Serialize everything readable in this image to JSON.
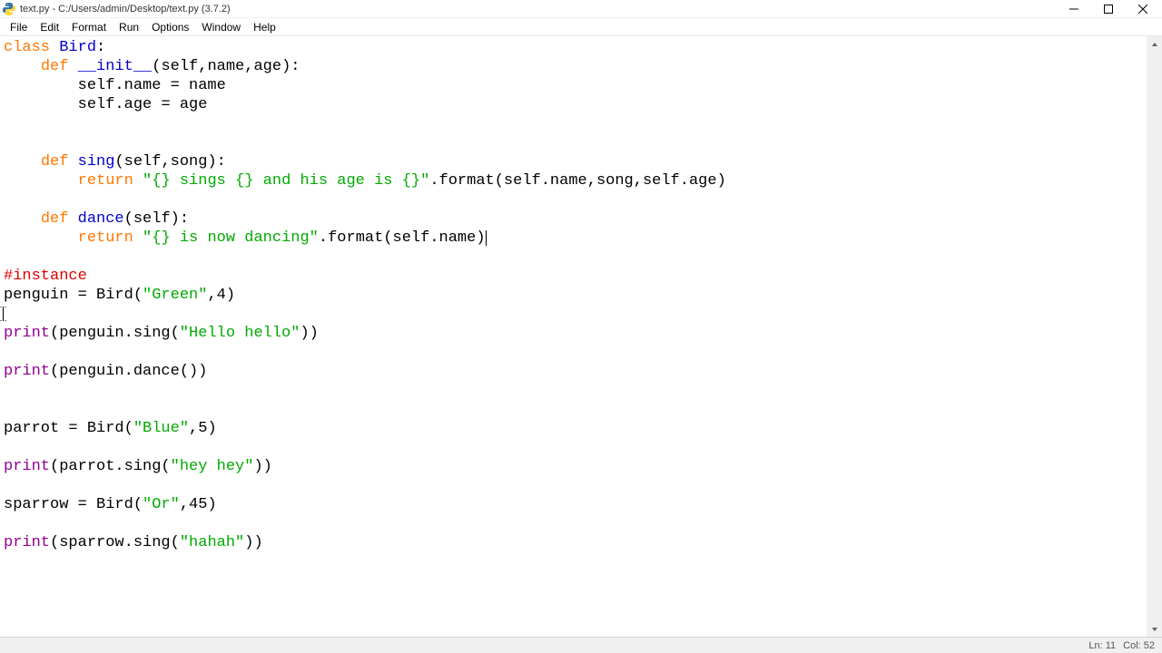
{
  "window": {
    "title": "text.py - C:/Users/admin/Desktop/text.py (3.7.2)"
  },
  "menu": {
    "file": "File",
    "edit": "Edit",
    "format": "Format",
    "run": "Run",
    "options": "Options",
    "window": "Window",
    "help": "Help"
  },
  "code": {
    "l1_kw": "class",
    "l1_name": " Bird",
    "l1_colon": ":",
    "l2_indent": "    ",
    "l2_kw": "def",
    "l2_name": " __init__",
    "l2_rest": "(self,name,age):",
    "l3": "        self.name = name",
    "l4": "        self.age = age",
    "l7_indent": "    ",
    "l7_kw": "def",
    "l7_name": " sing",
    "l7_rest": "(self,song):",
    "l8_indent": "        ",
    "l8_kw": "return",
    "l8_sp": " ",
    "l8_str": "\"{} sings {} and his age is {}\"",
    "l8_rest": ".format(self.name,song,self.age)",
    "l10_indent": "    ",
    "l10_kw": "def",
    "l10_name": " dance",
    "l10_rest": "(self):",
    "l11_indent": "        ",
    "l11_kw": "return",
    "l11_sp": " ",
    "l11_str": "\"{} is now dancing\"",
    "l11_rest": ".format(self.name)",
    "l13_comment": "#instance",
    "l14_a": "penguin = Bird(",
    "l14_str": "\"Green\"",
    "l14_b": ",4)",
    "l16_print": "print",
    "l16_a": "(penguin.sing(",
    "l16_str": "\"Hello hello\"",
    "l16_b": "))",
    "l18_print": "print",
    "l18_rest": "(penguin.dance())",
    "l21_a": "parrot = Bird(",
    "l21_str": "\"Blue\"",
    "l21_b": ",5)",
    "l23_print": "print",
    "l23_a": "(parrot.sing(",
    "l23_str": "\"hey hey\"",
    "l23_b": "))",
    "l25_a": "sparrow = Bird(",
    "l25_str": "\"Or\"",
    "l25_b": ",45)",
    "l27_print": "print",
    "l27_a": "(sparrow.sing(",
    "l27_str": "\"hahah\"",
    "l27_b": "))"
  },
  "status": {
    "ln": "Ln: 11",
    "col": "Col: 52"
  }
}
